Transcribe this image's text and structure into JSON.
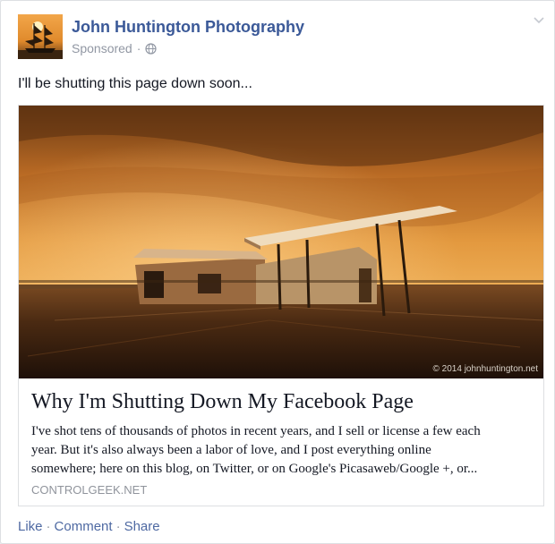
{
  "post": {
    "page_name": "John Huntington Photography",
    "sponsored_label": "Sponsored",
    "separator": "·",
    "message": "I'll be shutting this page down soon..."
  },
  "card": {
    "watermark": "© 2014 johnhuntington.net",
    "title": "Why I'm Shutting Down My Facebook Page",
    "description_lines": [
      "I've shot tens of thousands of photos in recent years, and I sell or license a few each",
      "year. But it's also always been a labor of love, and I post everything online",
      "somewhere; here on this blog, on Twitter, or on Google's Picasaweb/Google +, or..."
    ],
    "domain": "CONTROLGEEK.NET"
  },
  "actions": {
    "like": "Like",
    "comment": "Comment",
    "share": "Share",
    "separator": "·"
  },
  "icons": {
    "avatar": "sailing-ship-sunset-icon",
    "audience": "globe-icon",
    "menu": "chevron-down-icon"
  },
  "colors": {
    "link_blue": "#3b5998",
    "action_blue": "#4e69a2",
    "meta_gray": "#9197a3",
    "sky_orange": "#d8893a"
  }
}
